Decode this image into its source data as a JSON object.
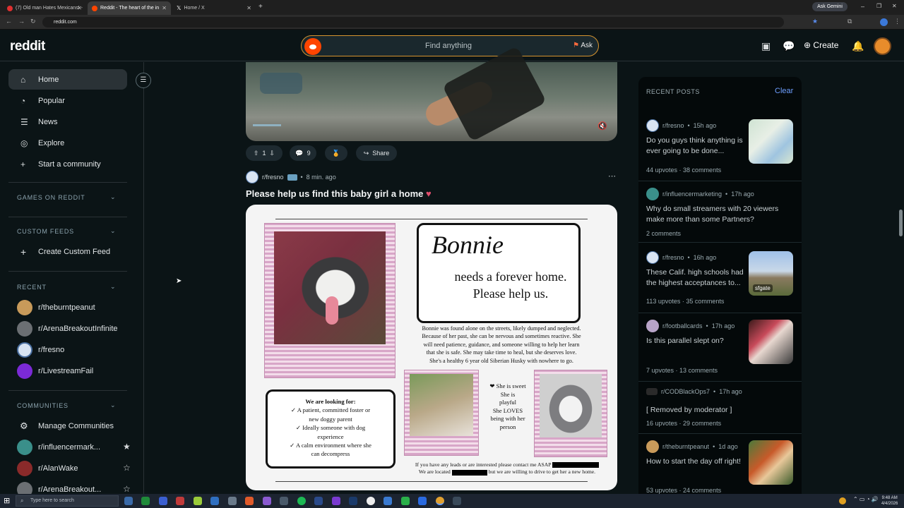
{
  "browser": {
    "tabs": [
      {
        "label": "(7) Old man Hates Mexicans! -",
        "active": false,
        "color": "#e03030"
      },
      {
        "label": "Reddit - The heart of the in",
        "active": true,
        "color": "#ff4500"
      },
      {
        "label": "Home / X",
        "active": false,
        "color": "#ffffff"
      }
    ],
    "url": "reddit.com",
    "gemini_label": "Ask Gemini"
  },
  "header": {
    "logo": "reddit",
    "search_placeholder": "Find anything",
    "ask_label": "Ask",
    "create_label": "Create"
  },
  "sidebar": {
    "nav": [
      {
        "label": "Home",
        "icon": "home-icon"
      },
      {
        "label": "Popular",
        "icon": "popular-icon"
      },
      {
        "label": "News",
        "icon": "news-icon"
      },
      {
        "label": "Explore",
        "icon": "explore-icon"
      },
      {
        "label": "Start a community",
        "icon": "plus-icon"
      }
    ],
    "games_heading": "GAMES ON REDDIT",
    "custom_feeds_heading": "CUSTOM FEEDS",
    "create_custom_feed": "Create Custom Feed",
    "recent_heading": "RECENT",
    "recent": [
      {
        "label": "r/theburntpeanut",
        "color": "#c89a5a"
      },
      {
        "label": "r/ArenaBreakoutInfinite",
        "color": "#6b6f73"
      },
      {
        "label": "r/fresno",
        "color": "#d9e4f2"
      },
      {
        "label": "r/LivestreamFail",
        "color": "#7b2ad6"
      }
    ],
    "communities_heading": "COMMUNITIES",
    "manage_communities": "Manage Communities",
    "communities": [
      {
        "label": "r/influencermark...",
        "color": "#3a8f8a",
        "favorite": true
      },
      {
        "label": "r/AlanWake",
        "color": "#8a2a2a",
        "favorite": false
      },
      {
        "label": "r/ArenaBreakout...",
        "color": "#6b6f73",
        "favorite": false
      }
    ]
  },
  "feed": {
    "prev_post_actions": {
      "upvotes": "1",
      "comments": "9",
      "share": "Share"
    },
    "post": {
      "subreddit": "r/fresno",
      "time": "8 min. ago",
      "title": "Please help us find this baby girl a home",
      "poster": {
        "name": "Bonnie",
        "headline": "needs a forever home. Please help us.",
        "story": [
          "Bonnie was found alone on the streets, likely dumped and neglected.",
          "Because of her past, she can be nervous and sometimes reactive. She",
          "will need patience, guidance, and someone willing to help her learn",
          "that she is safe. She may take time to heal, but she deserves love.",
          "She's a healthy 6 year old Siberian Husky with nowhere to go."
        ],
        "looking_for": [
          "We are looking for:",
          "✓ A patient, committed foster  or",
          "new doggy parent",
          "✓ Ideally someone with dog",
          "experience",
          "✓ A calm environment where she",
          "can decompress"
        ],
        "traits": [
          "❤ She is sweet",
          "She is",
          "playful",
          "She LOVES",
          "being with her",
          "person"
        ],
        "contact_1": "If you have any leads or are interested please contact me ASAP",
        "contact_2a": "We are located",
        "contact_2b": "but we are willing to drive to get her a new home."
      }
    }
  },
  "recent_posts": {
    "heading": "RECENT POSTS",
    "clear": "Clear",
    "items": [
      {
        "sub": "r/fresno",
        "time": "15h ago",
        "title": "Do you guys think anything is ever going to be done...",
        "upvotes": "44 upvotes",
        "comments": "38 comments",
        "thumb": "map"
      },
      {
        "sub": "r/influencermarketing",
        "time": "17h ago",
        "title": "Why do small streamers with 20 viewers make more than some Partners?",
        "upvotes": "",
        "comments": "2 comments",
        "thumb": "none"
      },
      {
        "sub": "r/fresno",
        "time": "16h ago",
        "title": "These Calif. high schools had the highest acceptances to...",
        "upvotes": "113 upvotes",
        "comments": "35 comments",
        "thumb": "sfgate",
        "thumb_label": "sfgate"
      },
      {
        "sub": "r/footballcards",
        "time": "17h ago",
        "title": "Is this parallel slept on?",
        "upvotes": "7 upvotes",
        "comments": "13 comments",
        "thumb": "card"
      },
      {
        "sub": "r/CODBlackOps7",
        "time": "17h ago",
        "title": "[ Removed by moderator ]",
        "upvotes": "16 upvotes",
        "comments": "29 comments",
        "thumb": "none"
      },
      {
        "sub": "r/theburntpeanut",
        "time": "1d ago",
        "title": "How to start the day off right!",
        "upvotes": "53 upvotes",
        "comments": "24 comments",
        "thumb": "can"
      }
    ]
  },
  "taskbar": {
    "search_placeholder": "Type here to search",
    "time": "9:48 AM",
    "date": "4/4/2026"
  }
}
